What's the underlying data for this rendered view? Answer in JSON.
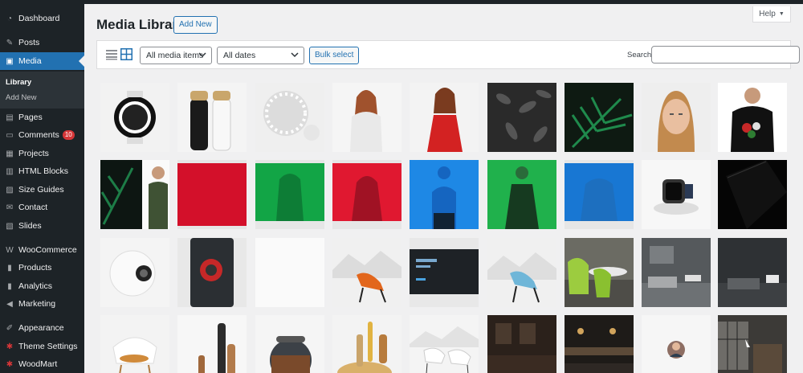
{
  "sidebar": {
    "items": [
      {
        "label": "Dashboard",
        "icon": "dashboard-icon"
      },
      {
        "label": "Posts",
        "icon": "pin-icon"
      },
      {
        "label": "Media",
        "icon": "media-icon",
        "active": true
      },
      {
        "label": "Pages",
        "icon": "page-icon"
      },
      {
        "label": "Comments",
        "icon": "comment-icon",
        "badge": "10"
      },
      {
        "label": "Projects",
        "icon": "projects-icon"
      },
      {
        "label": "HTML Blocks",
        "icon": "blocks-icon"
      },
      {
        "label": "Size Guides",
        "icon": "size-guide-icon"
      },
      {
        "label": "Contact",
        "icon": "mail-icon"
      },
      {
        "label": "Slides",
        "icon": "slides-icon"
      },
      {
        "label": "WooCommerce",
        "icon": "woocommerce-icon"
      },
      {
        "label": "Products",
        "icon": "products-icon"
      },
      {
        "label": "Analytics",
        "icon": "analytics-icon"
      },
      {
        "label": "Marketing",
        "icon": "megaphone-icon"
      },
      {
        "label": "Appearance",
        "icon": "brush-icon"
      },
      {
        "label": "Theme Settings",
        "icon": "settings-icon"
      },
      {
        "label": "WoodMart",
        "icon": "woodmart-icon"
      }
    ],
    "media_submenu": [
      "Library",
      "Add New"
    ]
  },
  "header": {
    "title": "Media Library",
    "add_new": "Add New",
    "help": "Help"
  },
  "toolbar": {
    "filter_type": "All media items",
    "filter_date": "All dates",
    "bulk_select": "Bulk select",
    "search_label": "Search",
    "search_value": ""
  },
  "colors": {
    "sidebar_bg": "#1d2327",
    "accent": "#2271b1",
    "badge": "#d63638"
  },
  "grid_rows": [
    [
      "watch-white",
      "salt-pepper-mills",
      "white-sphere",
      "woman-white-top",
      "woman-red-dress",
      "dark-leaves",
      "palm-leaves",
      "woman-portrait",
      "man-tshirt"
    ],
    [
      "palm-man-split",
      "red-banner",
      "green-model",
      "red-model",
      "blue-model",
      "green-dress-model",
      "blue-fade",
      "smartwatch-charger",
      "black-phone"
    ],
    [
      "white-speaker",
      "phone-red-camera",
      "blank-white",
      "orange-lounge-chair",
      "dark-web-banner",
      "blue-lounge-chair",
      "green-chairs-interior",
      "grey-interior",
      "dark-interior"
    ],
    [
      "white-eames-chair",
      "wooden-pepper-mills",
      "glass-jar",
      "wooden-vases",
      "white-chairs",
      "dark-restaurant",
      "dark-bar-interior",
      "avatar-circle",
      "loft-interior"
    ]
  ]
}
